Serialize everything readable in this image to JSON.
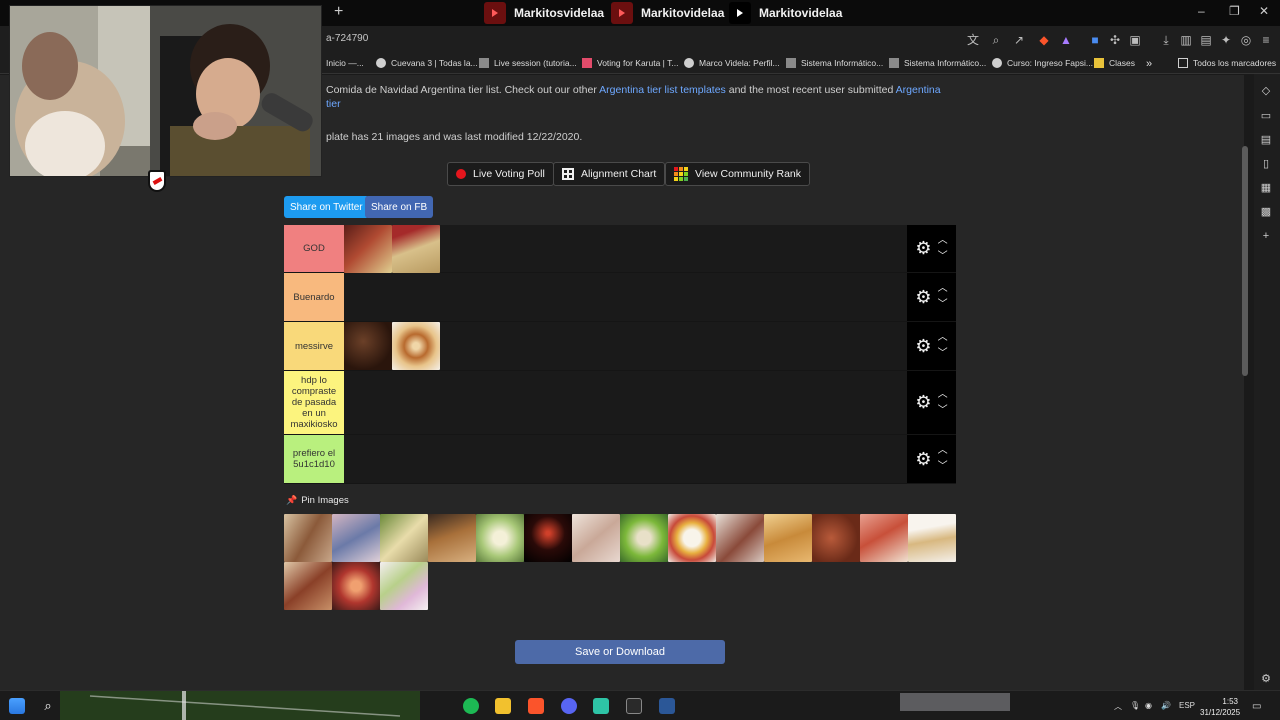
{
  "browser": {
    "tabs": [
      {
        "label": "Markitosvidelaa"
      },
      {
        "label": "Markitovidelaa"
      },
      {
        "label": "Markitovidelaa"
      }
    ],
    "url": "a-724790",
    "bookmarks": [
      {
        "label": "Inicio —..."
      },
      {
        "label": "Cuevana 3 | Todas la..."
      },
      {
        "label": "Live session (tutoria..."
      },
      {
        "label": "Voting for Karuta | T..."
      },
      {
        "label": "Marco Videla: Perfil..."
      },
      {
        "label": "Sistema Informático..."
      },
      {
        "label": "Sistema Informático..."
      },
      {
        "label": "Curso: Ingreso Fapsi..."
      },
      {
        "label": "Clases"
      },
      {
        "label": "Todos los marcadores"
      }
    ]
  },
  "page": {
    "desc_prefix": "Comida de Navidad Argentina tier list. Check out our other ",
    "desc_link1": "Argentina tier list templates",
    "desc_middle": " and the most recent user submitted ",
    "desc_link2": "Argentina tier",
    "meta": "plate has 21 images and was last modified 12/22/2020.",
    "buttons": {
      "live_poll": "Live Voting Poll",
      "alignment": "Alignment Chart",
      "community": "View Community Rank"
    },
    "share": {
      "twitter": "Share on Twitter",
      "fb": "Share on FB"
    },
    "tiers": [
      {
        "label": "GOD",
        "color": "#f08080",
        "items": [
          "#8a3a2a",
          "#c9b48a"
        ]
      },
      {
        "label": "Buenardo",
        "color": "#f8b97e",
        "items": []
      },
      {
        "label": "messirve",
        "color": "#f9d97a",
        "items": [
          "#3b2418",
          "#c88a52"
        ]
      },
      {
        "label": "hdp lo compraste de pasada en un maxikiosko",
        "color": "#fcf47e",
        "items": []
      },
      {
        "label": "prefiero el 5u1c1d10",
        "color": "#b9f07e",
        "items": []
      }
    ],
    "pin_label": "Pin Images",
    "pool": [
      "#b08a68",
      "#a88a92",
      "#c9c08a",
      "#8b6a48",
      "#c7d3a8",
      "#3a1a10",
      "#d9c7b8",
      "#9cc26a",
      "#e8dcc6",
      "#b8a896",
      "#d8a25a",
      "#8a4a2e",
      "#c9665a",
      "#e5d9c2",
      "#a8684a",
      "#b0362e",
      "#e8d6e0"
    ],
    "save_label": "Save or Download"
  },
  "taskbar": {
    "lang": "ESP",
    "time": "1:53",
    "date": "31/12/2025"
  }
}
